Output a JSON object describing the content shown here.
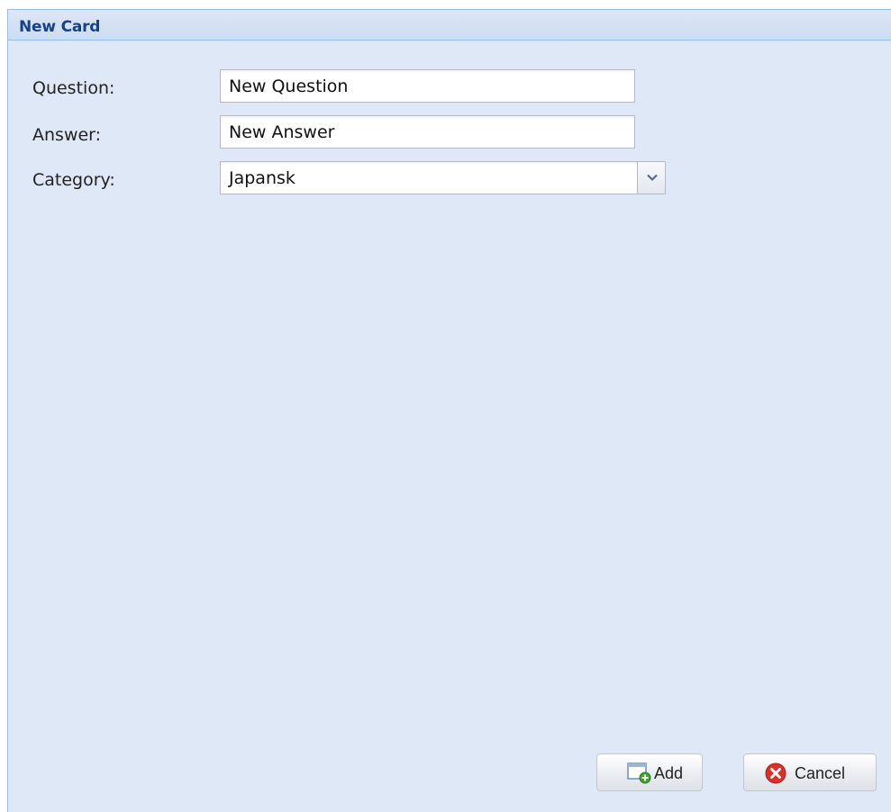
{
  "panel": {
    "title": "New Card"
  },
  "form": {
    "question": {
      "label": "Question:",
      "value": "New Question"
    },
    "answer": {
      "label": "Answer:",
      "value": "New Answer"
    },
    "category": {
      "label": "Category:",
      "value": "Japansk"
    }
  },
  "buttons": {
    "add": {
      "label": "Add",
      "icon": "add-card-icon"
    },
    "cancel": {
      "label": "Cancel",
      "icon": "cancel-icon"
    }
  },
  "colors": {
    "panel_background": "#dfe8f6",
    "header_text": "#15428b",
    "border": "#99bbe8",
    "cancel_icon": "#d9302a",
    "add_icon": "#3aa52a"
  }
}
